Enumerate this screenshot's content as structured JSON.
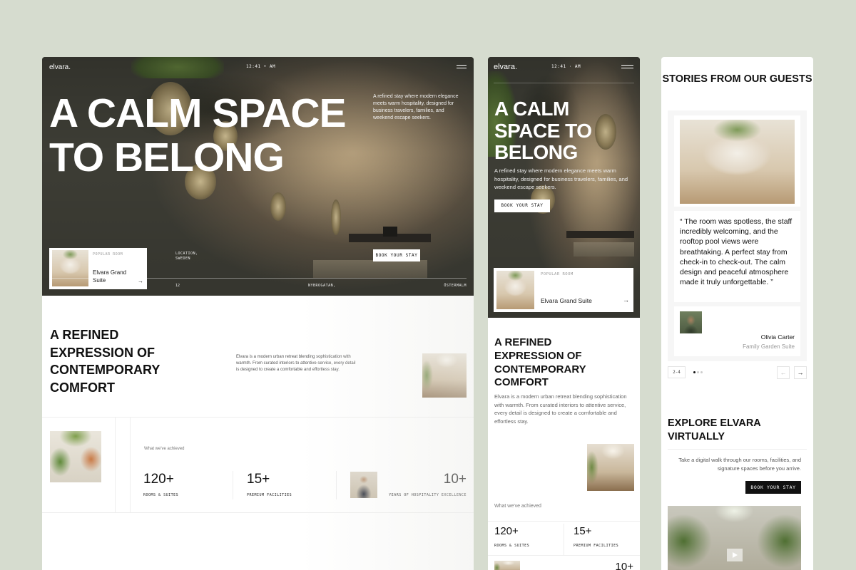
{
  "desktop": {
    "logo": "elvara.",
    "time": "12:41 • AM",
    "hero_title": "A CALM SPACE TO BELONG",
    "hero_desc": "A refined stay where modern elegance meets warm hospitality, designed for business travelers, families, and weekend escape seekers.",
    "popular_room": {
      "tag": "POPULAR ROOM",
      "name": "Elvara Grand Suite",
      "arrow": "→"
    },
    "location": "LOCATION, SWEDEN",
    "book_button": "BOOK YOUR STAY",
    "footer_num": "12",
    "footer_street": "NYBROGATAN,",
    "footer_city": "ÖSTERMALM",
    "refined_title": "A REFINED EXPRESSION OF CONTEMPORARY COMFORT",
    "refined_text": "Elvara is a modern urban retreat blending sophistication with warmth. From curated interiors to attentive service, every detail is designed to create a comfortable and effortless stay.",
    "achieved_label": "What we've achieved",
    "stats": [
      {
        "value": "120+",
        "label": "ROOMS & SUITES"
      },
      {
        "value": "15+",
        "label": "PREMIUM FACILITIES"
      },
      {
        "value": "10+",
        "label": "YEARS OF HOSPITALITY EXCELLENCE"
      }
    ]
  },
  "mobile": {
    "logo": "elvara.",
    "time": "12:41 · AM",
    "hero_title": "A CALM SPACE TO BELONG",
    "hero_desc": "A refined stay where modern elegance meets warm hospitality, designed for business travelers, families, and weekend escape seekers.",
    "book_button": "BOOK YOUR STAY",
    "popular_room": {
      "tag": "POPULAR ROOM",
      "name": "Elvara Grand Suite",
      "arrow": "→"
    },
    "refined_title": "A REFINED EXPRESSION OF CONTEMPORARY COMFORT",
    "refined_text": "Elvara is a modern urban retreat blending sophistication with warmth. From curated interiors to attentive service, every detail is designed to create a comfortable and effortless stay.",
    "achieved_label": "What we've achieved",
    "stats": [
      {
        "value": "120+",
        "label": "ROOMS & SUITES"
      },
      {
        "value": "15+",
        "label": "PREMIUM FACILITIES"
      },
      {
        "value": "10+",
        "label": ""
      }
    ]
  },
  "guests": {
    "title": "STORIES FROM OUR GUESTS",
    "quote": "“ The room was spotless, the staff incredibly welcoming, and the rooftop pool views were breathtaking. A perfect stay from check-in to check-out. The calm design and peaceful atmosphere made it truly unforgettable. ”",
    "reviewer_name": "Olivia Carter",
    "reviewer_suite": "Family Garden Suite",
    "counter": "2-4",
    "prev_arrow": "←",
    "next_arrow": "→",
    "explore_title": "EXPLORE ELVARA VIRTUALLY",
    "explore_text": "Take a digital walk through our rooms, facilities, and signature spaces before you arrive.",
    "book_button": "BOOK YOUR STAY"
  },
  "colors": {
    "background": "#d6dccf",
    "hero_overlay": "#4d4f45",
    "button_dark": "#111111",
    "text_primary": "#111111"
  },
  "icons": [
    "menu-icon",
    "arrow-right-icon",
    "arrow-left-icon",
    "play-icon"
  ]
}
